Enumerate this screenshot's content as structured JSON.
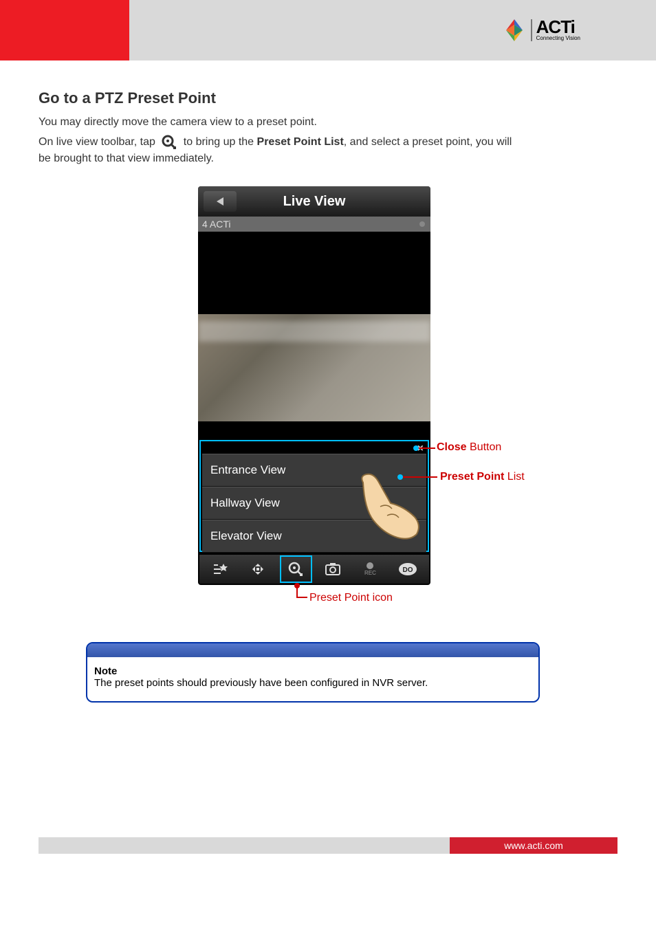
{
  "brand": {
    "name": "ACTi",
    "tagline": "Connecting Vision"
  },
  "section": {
    "title": "Go to a PTZ Preset Point"
  },
  "body": {
    "line1": "You may directly move the camera view to a preset point.",
    "line2_a": "On live view toolbar, tap",
    "line2_b": "to bring up the",
    "line2_bold": "Preset Point List",
    "line2_c": ", and select a preset point, you will",
    "line3": "be brought to that view immediately."
  },
  "phone": {
    "title": "Live View",
    "camera_label": "4 ACTi",
    "presets": [
      "Entrance View",
      "Hallway View",
      "Elevator View"
    ],
    "toolbar_icons": [
      "preset-star-icon",
      "ptz-icon",
      "zoom-preset-icon",
      "snapshot-icon",
      "record-icon",
      "do-icon"
    ],
    "rec_label": "REC",
    "do_label": "DO"
  },
  "callouts": {
    "close_bold": "Close",
    "close_rest": " Button",
    "preset_list_bold": "Preset Point",
    "preset_list_rest": " List",
    "preset_icon": "Preset Point icon"
  },
  "note": {
    "title": "Note",
    "body": "The preset points should previously have been configured in NVR server."
  },
  "footer": {
    "url": "www.acti.com"
  },
  "chart_data": null
}
